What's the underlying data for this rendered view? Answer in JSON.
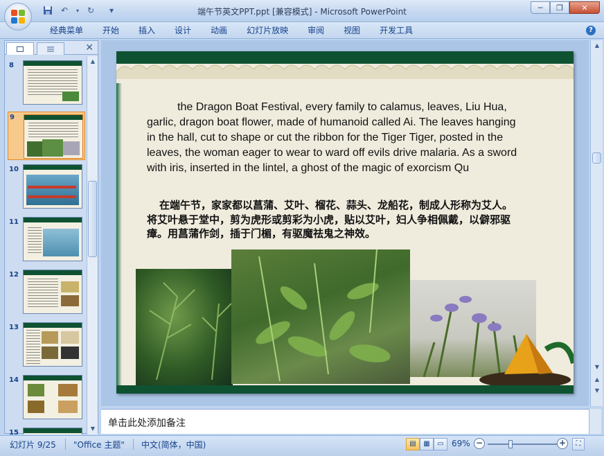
{
  "window": {
    "title": "端午节英文PPT.ppt [兼容模式] - Microsoft PowerPoint",
    "minimize": "─",
    "restore": "❐",
    "close": "✕"
  },
  "qat": {
    "save": "💾",
    "undo": "↶",
    "redo": "↻",
    "customize": "▾"
  },
  "ribbon": {
    "tabs": [
      "经典菜单",
      "开始",
      "插入",
      "设计",
      "动画",
      "幻灯片放映",
      "审阅",
      "视图",
      "开发工具"
    ],
    "help": "?"
  },
  "left_panel": {
    "close": "✕",
    "slide_numbers": [
      "8",
      "9",
      "10",
      "11",
      "12",
      "13",
      "14",
      "15"
    ],
    "selected": "9"
  },
  "slide": {
    "english": "the Dragon Boat Festival, every family to calamus, leaves, Liu Hua, garlic, dragon boat flower, made of humanoid called Ai. The leaves hanging in the hall, cut to shape or cut the ribbon for the Tiger Tiger, posted in the leaves, the woman eager to wear to ward off evils drive malaria. As a sword with iris, inserted in the lintel, a ghost of the magic of exorcism Qu",
    "chinese": "在端午节，家家都以菖蒲、艾叶、榴花、蒜头、龙船花，制成人形称为艾人。将艾叶悬于堂中，剪为虎形或剪彩为小虎，贴以艾叶，妇人争相佩戴，以僻邪驱瘴。用菖蒲作剑，插于门楣，有驱魔祛鬼之神效。"
  },
  "notes": {
    "placeholder": "单击此处添加备注"
  },
  "status": {
    "slide_info": "幻灯片 9/25",
    "theme": "\"Office 主题\"",
    "language": "中文(简体，中国)",
    "zoom": "69%",
    "zoom_value": 69
  },
  "colors": {
    "slide_band": "#0f5232",
    "slide_bg": "#efebdd",
    "selected_thumb": "#f7c98b"
  }
}
